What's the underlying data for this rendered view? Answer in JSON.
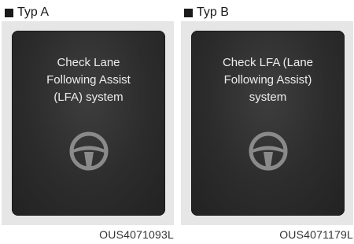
{
  "panels": [
    {
      "label": "Typ A",
      "message_lines": [
        "Check Lane",
        "Following Assist",
        "(LFA) system"
      ],
      "image_code": "OUS4071093L",
      "icon": "steering-wheel-icon"
    },
    {
      "label": "Typ B",
      "message_lines": [
        "Check LFA (Lane",
        "Following Assist)",
        "system"
      ],
      "image_code": "OUS4071179L",
      "icon": "steering-wheel-icon"
    }
  ],
  "colors": {
    "screen": "#2c2c2c",
    "bezel": "#e6e6e6",
    "text": "#ededed",
    "icon": "#8a8a8a"
  }
}
